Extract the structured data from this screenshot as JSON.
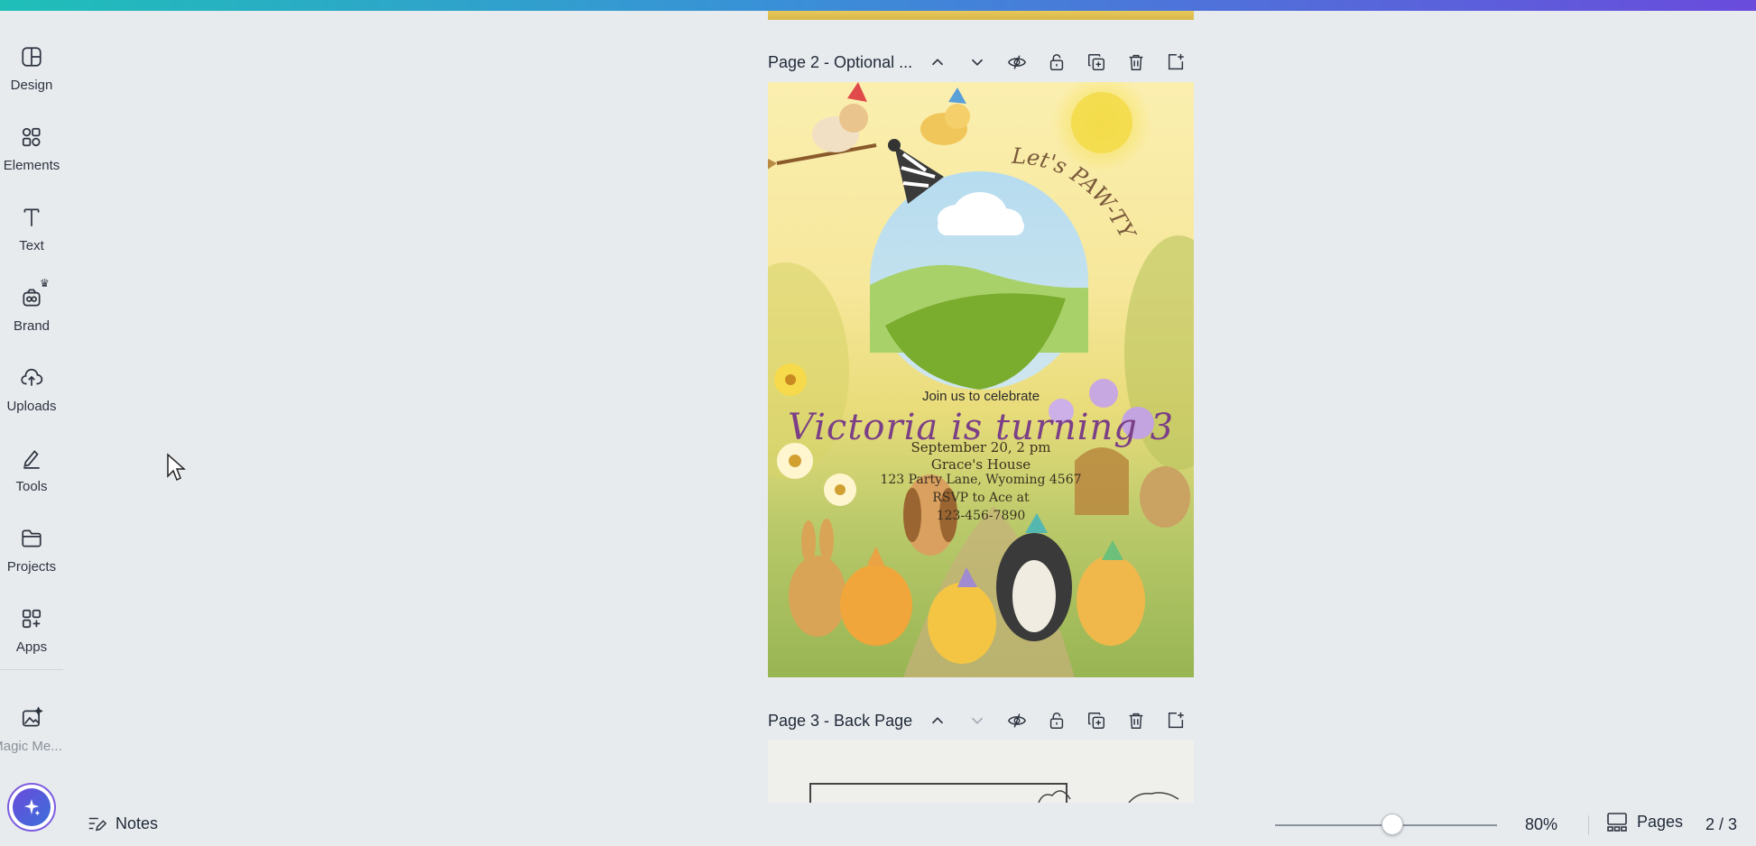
{
  "sidebar": {
    "items": [
      {
        "label": "Design",
        "icon": "design-icon"
      },
      {
        "label": "Elements",
        "icon": "elements-icon"
      },
      {
        "label": "Text",
        "icon": "text-icon"
      },
      {
        "label": "Brand",
        "icon": "brand-icon"
      },
      {
        "label": "Uploads",
        "icon": "uploads-icon"
      },
      {
        "label": "Tools",
        "icon": "tools-icon"
      },
      {
        "label": "Projects",
        "icon": "projects-icon"
      },
      {
        "label": "Apps",
        "icon": "apps-icon"
      },
      {
        "label": "Magic Me...",
        "icon": "magic-media-icon"
      }
    ]
  },
  "pages": {
    "page2_title": "Page 2 - Optional ...",
    "page3_title": "Page 3 - Back Page"
  },
  "invitation": {
    "curved_text": "Let's PAW-TY",
    "join_line": "Join us to celebrate",
    "name_line": "Victoria is turning 3",
    "date_line": "September 20, 2 pm",
    "place_line": "Grace's House",
    "address_line": "123 Party Lane, Wyoming 4567",
    "rsvp_line": "RSVP to Ace at",
    "phone_line": "123-456-7890"
  },
  "bottombar": {
    "notes_label": "Notes",
    "zoom_value": "80%",
    "zoom_fraction": 0.48,
    "pages_label": "Pages",
    "page_count": "2 / 3"
  },
  "colors": {
    "accent_gradient_start": "#1fbfb8",
    "accent_gradient_end": "#6a4bdc",
    "name_text": "#7b3f87"
  }
}
